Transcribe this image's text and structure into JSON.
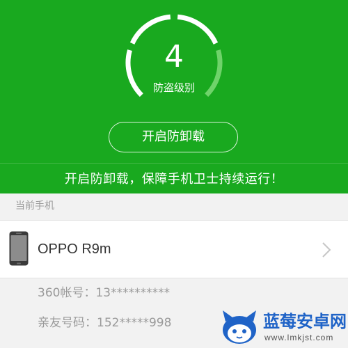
{
  "protection": {
    "level": "4",
    "level_label": "防盗级别",
    "gauge_segments_total": 4,
    "gauge_segments_filled": 3
  },
  "uninstall_button_label": "开启防卸载",
  "tip_text": "开启防卸载，保障手机卫士持续运行！",
  "current_phone": {
    "section_title": "当前手机",
    "device_name": "OPPO R9m",
    "account": "360帐号：13**********",
    "friend_number": "亲友号码：152*****998"
  },
  "watermark": {
    "title": "蓝莓安卓网",
    "url": "www.lmkjst.com"
  },
  "colors": {
    "header_green": "#19a91f",
    "page_background": "#f2f2f2",
    "card_background": "#ffffff",
    "muted_text": "#9a9a9a",
    "primary_text": "#333333",
    "watermark_blue": "#1f63c7"
  },
  "icons": [
    "protection-gauge",
    "phone-icon",
    "chevron-right-icon",
    "mascot-logo"
  ]
}
